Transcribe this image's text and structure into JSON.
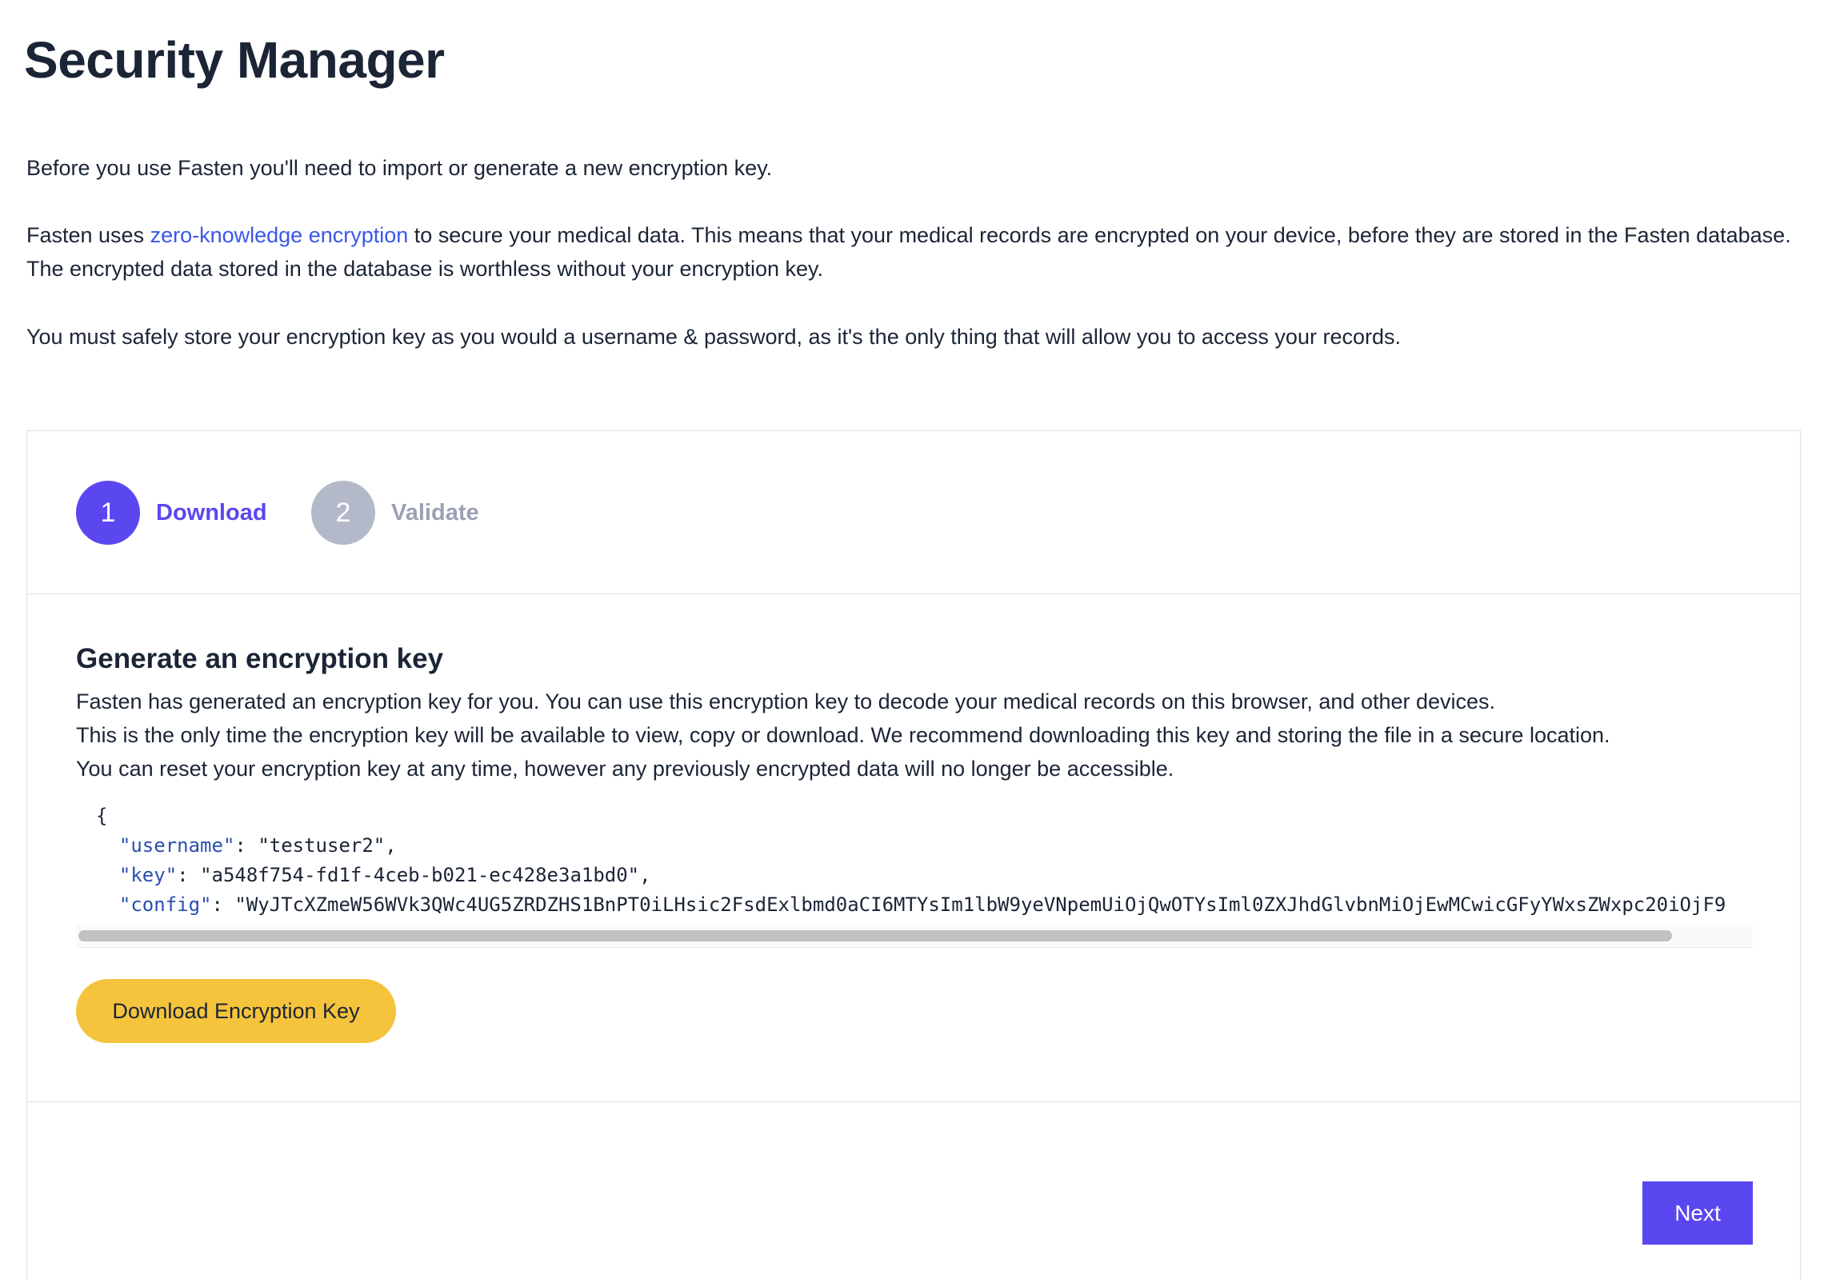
{
  "page": {
    "title": "Security Manager",
    "intro1": "Before you use Fasten you'll need to import or generate a new encryption key.",
    "intro2_before": "Fasten uses ",
    "intro2_link": "zero-knowledge encryption",
    "intro2_after": " to secure your medical data. This means that your medical records are encrypted on your device, before they are stored in the Fasten database. The encrypted data stored in the database is worthless without your encryption key.",
    "intro3": "You must safely store your encryption key as you would a username & password, as it's the only thing that will allow you to access your records."
  },
  "stepper": {
    "steps": [
      {
        "number": "1",
        "label": "Download",
        "state": "active"
      },
      {
        "number": "2",
        "label": "Validate",
        "state": "inactive"
      }
    ]
  },
  "section": {
    "title": "Generate an encryption key",
    "desc_lines": [
      "Fasten has generated an encryption key for you. You can use this encryption key to decode your medical records on this browser, and other devices.",
      "This is the only time the encryption key will be available to view, copy or download. We recommend downloading this key and storing the file in a secure location.",
      "You can reset your encryption key at any time, however any previously encrypted data will no longer be accessible."
    ]
  },
  "key_json": {
    "open_brace": "{",
    "close_brace": "}",
    "username_key": "\"username\"",
    "username_value": "\"testuser2\"",
    "key_key": "\"key\"",
    "key_value": "\"a548f754-fd1f-4ceb-b021-ec428e3a1bd0\"",
    "config_key": "\"config\"",
    "config_value": "\"WyJTcXZmeW56WVk3QWc4UG5ZRDZHS1BnPT0iLHsic2FsdExlbmd0aCI6MTYsIm1lbW9yeVNpemUiOjQwOTYsIml0ZXJhdGlvbnMiOjEwMCwicGFyYWxsZWxpc20iOjF9"
  },
  "scrollbar": {
    "horizontal_position": 0.0
  },
  "buttons": {
    "download": "Download Encryption Key",
    "next": "Next"
  },
  "colors": {
    "primary": "#5b47f0",
    "accent_yellow": "#f5c43c",
    "link": "#3a57e8",
    "text": "#1b2536",
    "inactive_step": "#b4b9c9",
    "json_key": "#2b4fb0"
  }
}
